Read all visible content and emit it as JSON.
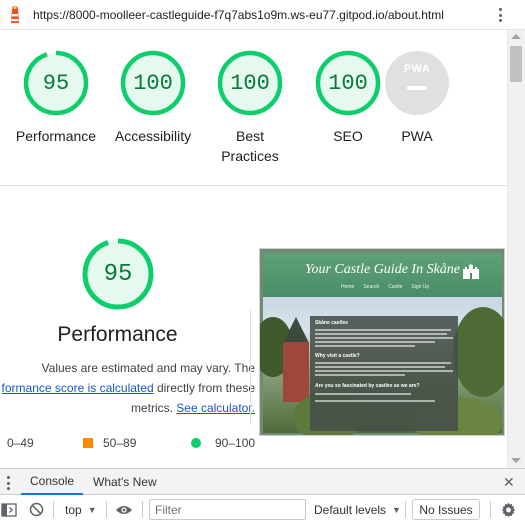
{
  "address_bar": {
    "url": "https://8000-moolleer-castleguide-f7q7abs1o9m.ws-eu77.gitpod.io/about.html"
  },
  "scores": [
    {
      "label": "Performance",
      "value": "95",
      "score": 0.95
    },
    {
      "label": "Accessibility",
      "value": "100",
      "score": 1.0
    },
    {
      "label": "Best Practices",
      "value": "100",
      "score": 1.0
    },
    {
      "label": "SEO",
      "value": "100",
      "score": 1.0
    }
  ],
  "pwa": {
    "badge": "PWA",
    "label": "PWA"
  },
  "performance_detail": {
    "score": "95",
    "title": "Performance",
    "desc_line1": "Values are estimated and may vary. The",
    "desc_link1": "formance score is calculated",
    "desc_line2_tail": " directly from these",
    "desc_line3_prefix": "metrics. ",
    "desc_link2": "See calculator."
  },
  "legend": [
    {
      "range": "0–49",
      "color": "#e53935",
      "shape": "triangle"
    },
    {
      "range": "50–89",
      "color": "#fb8c00",
      "shape": "square"
    },
    {
      "range": "90–100",
      "color": "#0cce6b",
      "shape": "circle"
    }
  ],
  "preview": {
    "site_title": "Your Castle Guide In Skåne",
    "nav": [
      "Home",
      "Search",
      "Castle",
      "Sign Up"
    ],
    "panel_heading_1": "Skåne castles",
    "panel_heading_2": "Why visit a castle?",
    "panel_heading_3": "Are you so fascinated by castles as we are?"
  },
  "devtools": {
    "tabs": [
      "Console",
      "What's New"
    ],
    "active_tab": "Console",
    "context": "top",
    "filter_placeholder": "Filter",
    "levels": "Default levels",
    "issues": "No Issues"
  },
  "colors": {
    "pass_green": "#0cce6b",
    "pass_fill": "#e5f9ee",
    "pass_text": "#0a7a3b",
    "link_blue": "#1a56c6"
  }
}
